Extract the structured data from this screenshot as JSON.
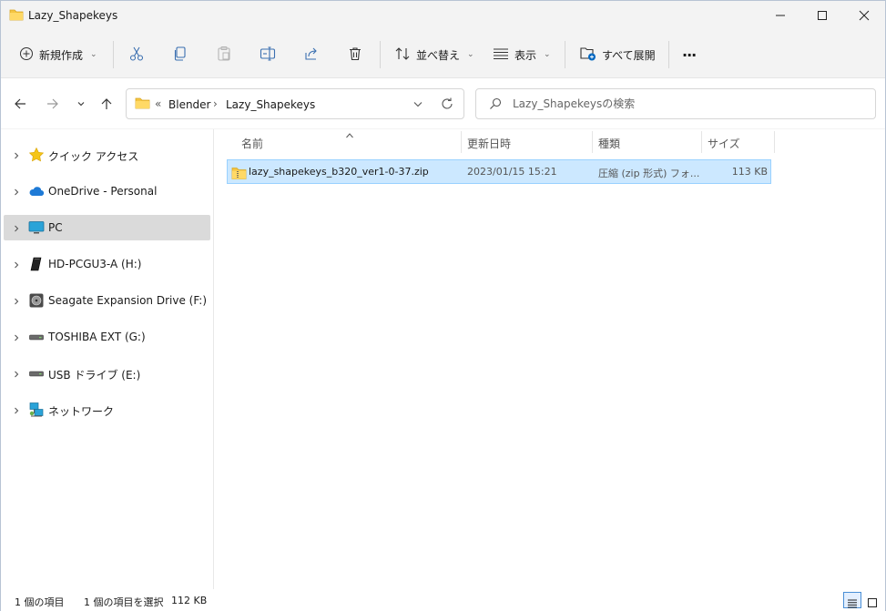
{
  "window": {
    "title": "Lazy_Shapekeys"
  },
  "toolbar": {
    "new_label": "新規作成",
    "sort_label": "並べ替え",
    "view_label": "表示",
    "expand_all_label": "すべて展開",
    "more_label": "···"
  },
  "address": {
    "overflow": "«",
    "crumbs": [
      "Blender",
      "Lazy_Shapekeys"
    ],
    "separator": "›"
  },
  "search": {
    "placeholder": "Lazy_Shapekeysの検索"
  },
  "nav": {
    "items": [
      {
        "label": "クイック アクセス",
        "icon": "star-icon"
      },
      {
        "label": "OneDrive - Personal",
        "icon": "cloud-icon"
      },
      {
        "label": "PC",
        "icon": "monitor-icon"
      },
      {
        "label": "HD-PCGU3-A (H:)",
        "icon": "portable-drive-icon"
      },
      {
        "label": "Seagate Expansion Drive (F:)",
        "icon": "hard-drive-icon"
      },
      {
        "label": "TOSHIBA EXT (G:)",
        "icon": "external-drive-icon"
      },
      {
        "label": "USB ドライブ (E:)",
        "icon": "usb-drive-icon"
      },
      {
        "label": "ネットワーク",
        "icon": "network-icon"
      }
    ],
    "selected_index": 2
  },
  "columns": {
    "name": "名前",
    "modified": "更新日時",
    "type": "種類",
    "size": "サイズ"
  },
  "files": [
    {
      "name": "lazy_shapekeys_b320_ver1-0-37.zip",
      "modified": "2023/01/15 15:21",
      "type": "圧縮 (zip 形式) フォ...",
      "size": "113 KB"
    }
  ],
  "status": {
    "item_count": "1 個の項目",
    "selected": "1 個の項目を選択",
    "selected_size": "112 KB"
  },
  "colors": {
    "accent": "#0067c0",
    "selection": "#cce8ff",
    "selection_border": "#99d1ff",
    "folder": "#f4c542"
  }
}
